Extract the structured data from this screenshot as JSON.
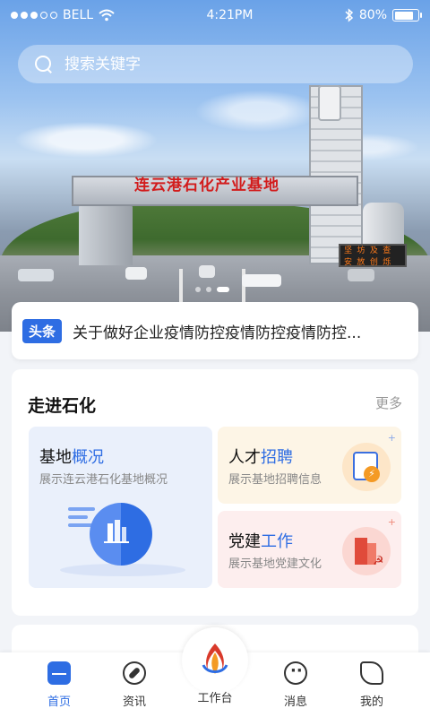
{
  "status_bar": {
    "carrier": "BELL",
    "time": "4:21PM",
    "battery": "80%",
    "battery_level": 0.8
  },
  "search": {
    "placeholder": "搜索关键字"
  },
  "banner": {
    "gantry_text": "连云港石化产业基地",
    "sign_line1": "坚 坊  及 查",
    "sign_line2": "安 放  创 烁",
    "slides": 3,
    "active_slide": 0
  },
  "headline": {
    "tag": "头条",
    "text": "关于做好企业疫情防控疫情防控疫情防控..."
  },
  "section": {
    "title": "走进石化",
    "more": "更多",
    "tiles": [
      {
        "title_prefix": "基地",
        "title_highlight": "概况",
        "desc": "展示连云港石化基地概况"
      },
      {
        "title_prefix": "人才",
        "title_highlight": "招聘",
        "desc": "展示基地招聘信息"
      },
      {
        "title_prefix": "党建",
        "title_highlight": "工作",
        "desc": "展示基地党建文化"
      }
    ]
  },
  "nav": {
    "items": [
      {
        "label": "首页",
        "icon": "home-icon"
      },
      {
        "label": "资讯",
        "icon": "compass-icon"
      },
      {
        "label": "工作台",
        "icon": "logo-icon"
      },
      {
        "label": "消息",
        "icon": "message-icon"
      },
      {
        "label": "我的",
        "icon": "leaf-icon"
      }
    ]
  },
  "colors": {
    "accent": "#2e6de3",
    "background": "#f2f4f8"
  }
}
